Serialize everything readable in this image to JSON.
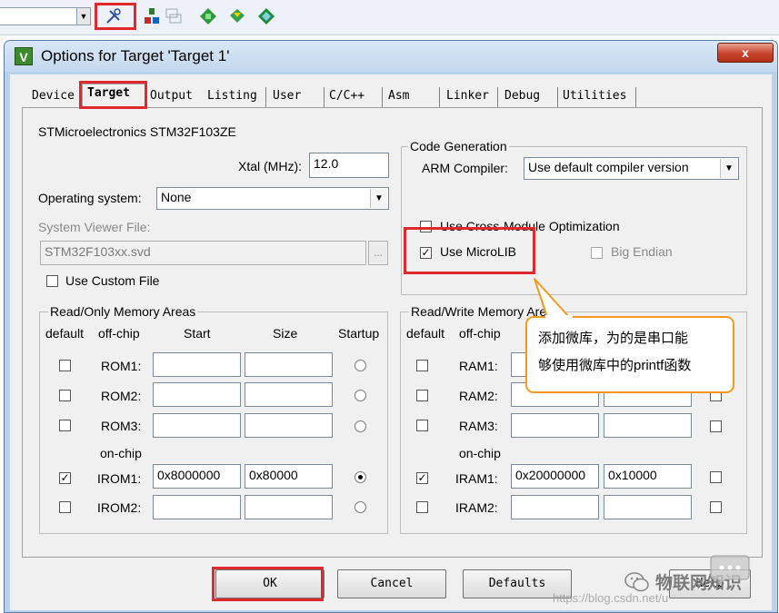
{
  "window": {
    "title": "Options for Target 'Target 1'",
    "icon_letter": "V",
    "close_glyph": "x"
  },
  "tabs": [
    {
      "label": "Device"
    },
    {
      "label": "Target"
    },
    {
      "label": "Output"
    },
    {
      "label": "Listing"
    },
    {
      "label": "User"
    },
    {
      "label": "C/C++"
    },
    {
      "label": "Asm"
    },
    {
      "label": "Linker"
    },
    {
      "label": "Debug"
    },
    {
      "label": "Utilities"
    }
  ],
  "target": {
    "device_name": "STMicroelectronics STM32F103ZE",
    "xtal_label": "Xtal (MHz):",
    "xtal_value": "12.0",
    "os_label": "Operating system:",
    "os_value": "None",
    "svd_label": "System Viewer File:",
    "svd_value": "STM32F103xx.svd",
    "browse_label": "...",
    "custom_file_label": "Use Custom File"
  },
  "code_gen": {
    "legend": "Code Generation",
    "compiler_label": "ARM Compiler:",
    "compiler_value": "Use default compiler version",
    "cross_module_label": "Use Cross-Module Optimization",
    "microlib_label": "Use MicroLIB",
    "big_endian_label": "Big Endian"
  },
  "rom": {
    "legend": "Read/Only Memory Areas",
    "headers": {
      "default": "default",
      "offchip": "off-chip",
      "start": "Start",
      "size": "Size",
      "startup": "Startup"
    },
    "onchip_label": "on-chip",
    "rows": [
      {
        "name": "ROM1:",
        "start": "",
        "size": ""
      },
      {
        "name": "ROM2:",
        "start": "",
        "size": ""
      },
      {
        "name": "ROM3:",
        "start": "",
        "size": ""
      },
      {
        "name": "IROM1:",
        "start": "0x8000000",
        "size": "0x80000"
      },
      {
        "name": "IROM2:",
        "start": "",
        "size": ""
      }
    ]
  },
  "ram": {
    "legend": "Read/Write Memory Areas",
    "headers": {
      "default": "default",
      "offchip": "off-chip"
    },
    "onchip_label": "on-chip",
    "rows": [
      {
        "name": "RAM1:",
        "start": "",
        "size": ""
      },
      {
        "name": "RAM2:",
        "start": "",
        "size": ""
      },
      {
        "name": "RAM3:",
        "start": "",
        "size": ""
      },
      {
        "name": "IRAM1:",
        "start": "0x20000000",
        "size": "0x10000"
      },
      {
        "name": "IRAM2:",
        "start": "",
        "size": ""
      }
    ]
  },
  "callout": {
    "line1": "添加微库，为的是串口能",
    "line2": "够使用微库中的printf函数"
  },
  "buttons": {
    "ok": "OK",
    "cancel": "Cancel",
    "defaults": "Defaults",
    "help": "Help"
  },
  "watermark": {
    "url": "https://blog.csdn.net/u",
    "brand": "物联网知识"
  },
  "toolbar": {
    "icons": [
      "target-options-icon",
      "manage-components-icon",
      "select-packs-icon",
      "pack-installer-icon",
      "batch-build-icon",
      "component-icon"
    ]
  },
  "colors": {
    "highlight": "#e0282e",
    "callout_border": "#f39a1e",
    "window_frame": "#b9d2ec"
  }
}
